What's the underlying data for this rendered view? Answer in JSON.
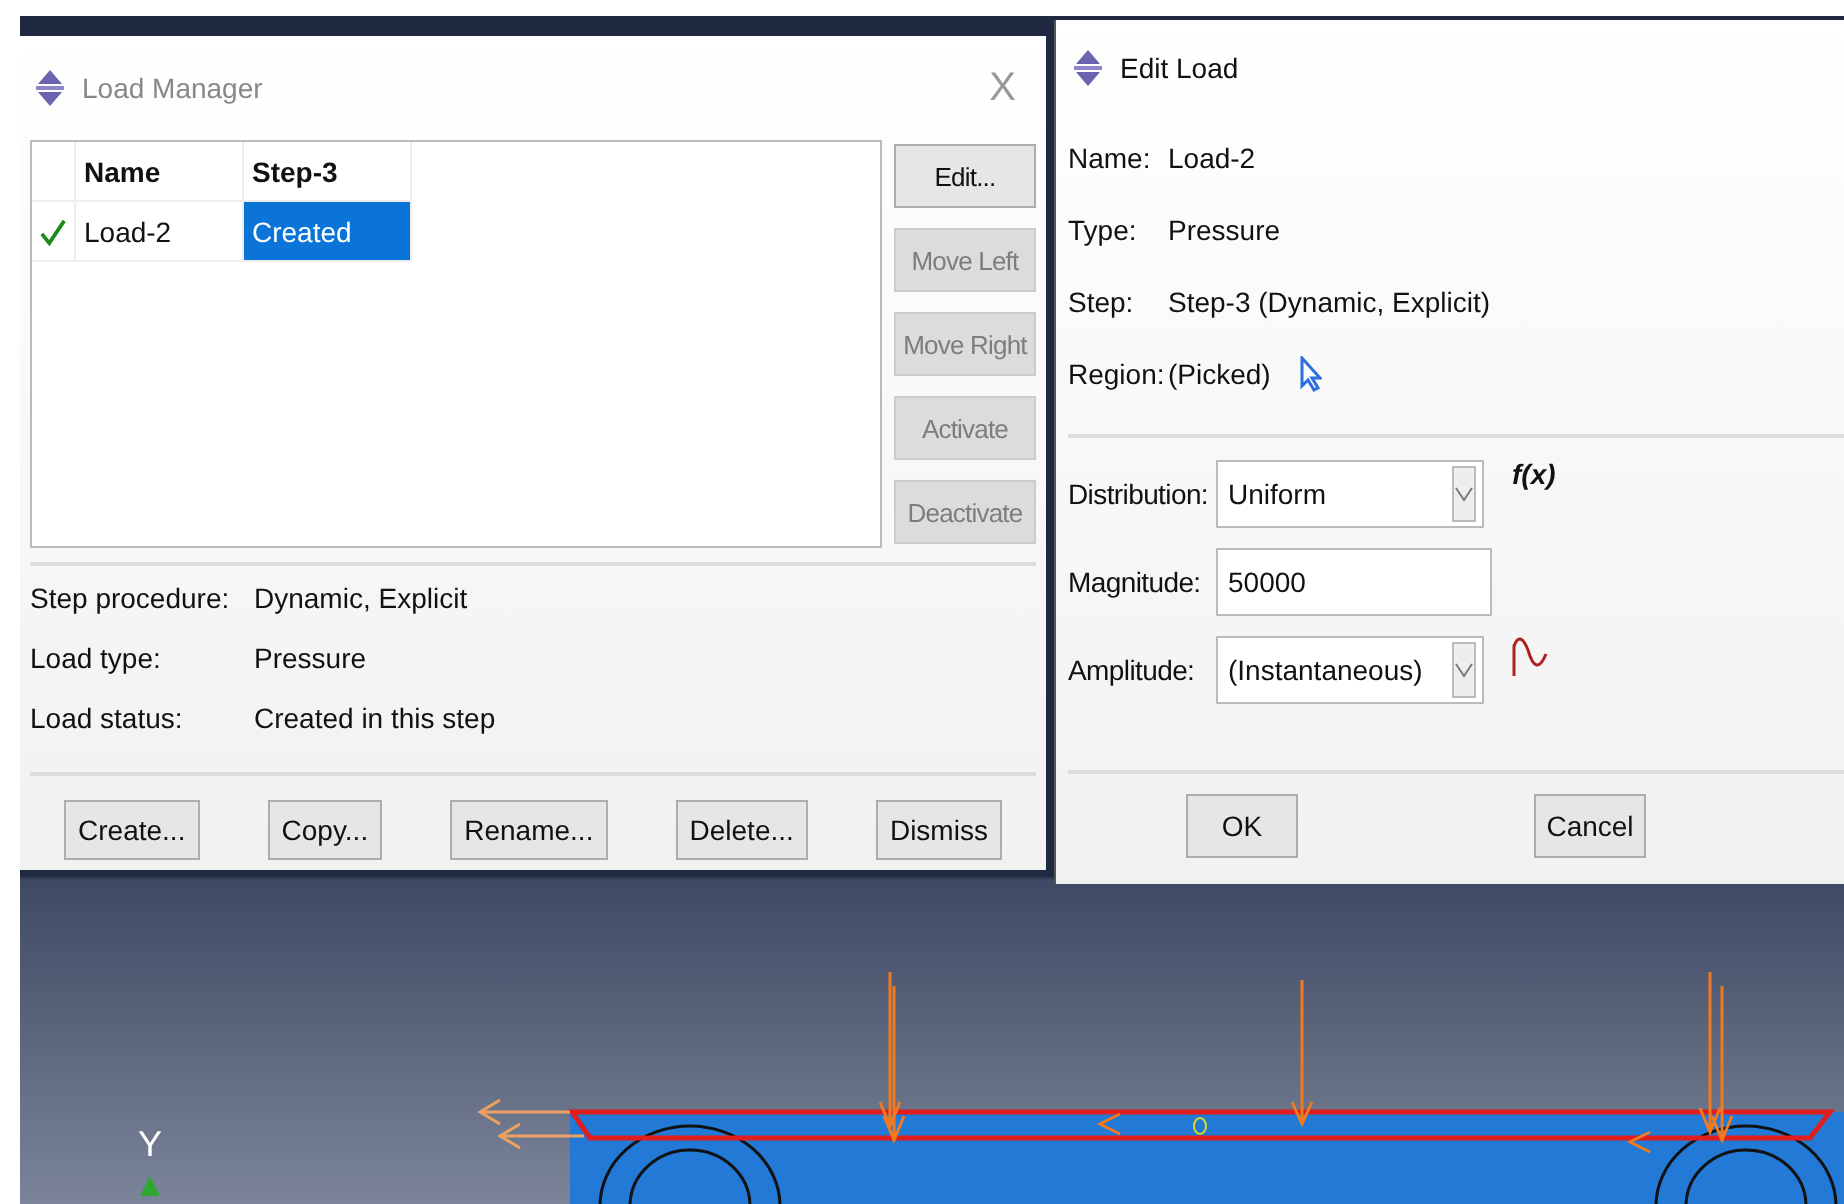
{
  "load_manager": {
    "title": "Load Manager",
    "close": "X",
    "columns": [
      "Name",
      "Step-3"
    ],
    "rows": [
      {
        "active": true,
        "name": "Load-2",
        "status": "Created",
        "selected": true
      }
    ],
    "side_buttons": [
      {
        "label": "Edit...",
        "disabled": false
      },
      {
        "label": "Move Left",
        "disabled": true
      },
      {
        "label": "Move Right",
        "disabled": true
      },
      {
        "label": "Activate",
        "disabled": true
      },
      {
        "label": "Deactivate",
        "disabled": true
      }
    ],
    "info": [
      {
        "label": "Step procedure:",
        "value": "Dynamic, Explicit"
      },
      {
        "label": "Load type:",
        "value": "Pressure"
      },
      {
        "label": "Load status:",
        "value": "Created in this step"
      }
    ],
    "buttons": [
      "Create...",
      "Copy...",
      "Rename...",
      "Delete...",
      "Dismiss"
    ]
  },
  "edit_load": {
    "title": "Edit Load",
    "info": [
      {
        "label": "Name:",
        "value": "Load-2",
        "kind": "text"
      },
      {
        "label": "Type:",
        "value": "Pressure",
        "kind": "text"
      },
      {
        "label": "Step:",
        "value": "Step-3 (Dynamic, Explicit)",
        "kind": "text"
      },
      {
        "label": "Region:",
        "value": "(Picked)",
        "kind": "pick"
      }
    ],
    "fields": [
      {
        "kind": "select",
        "label": "Distribution:",
        "value": "Uniform",
        "function_label": "f(x)"
      },
      {
        "kind": "text",
        "label": "Magnitude:",
        "value": "50000"
      },
      {
        "kind": "select",
        "label": "Amplitude:",
        "value": "(Instantaneous)",
        "amplitude_icon": true
      }
    ],
    "buttons": [
      "OK",
      "Cancel"
    ]
  },
  "viewport": {
    "axis_label": "Y"
  }
}
